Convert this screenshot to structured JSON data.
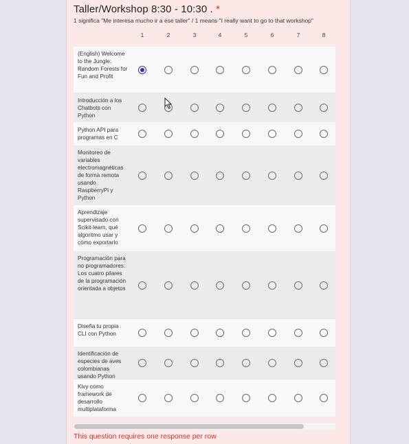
{
  "question": {
    "title": "Taller/Workshop 8:30 - 10:30 .",
    "required_mark": "*",
    "description": "1 significa \"Me interesa mucho ir a ese taller\" / 1 means \"I really want to go to that workshop\"",
    "error": "This question requires one response per row"
  },
  "columns": [
    "1",
    "2",
    "3",
    "4",
    "5",
    "6",
    "7",
    "8"
  ],
  "rows": [
    {
      "label": "(English) Welcome to the Jungle: Random Forests for Fun and Profit",
      "selected": "1"
    },
    {
      "label": "Introducción a los Chatbots con Python",
      "selected": null
    },
    {
      "label": "Python API para programas en C",
      "selected": null
    },
    {
      "label": "Monitoreo de variables electromagnéticas de forma remota usando RaspberryPi y Python",
      "selected": null
    },
    {
      "label": "Aprendizaje supervisado con Scikit-learn, qué algoritmo usar y cómo exportarlo",
      "selected": null
    },
    {
      "label": "Programación para no programadores: Los cuatro pilares de la programación orientada a objetos",
      "selected": null
    },
    {
      "label": "Diseña tu propia CLI con Python",
      "selected": null
    },
    {
      "label": "Identificación de especies de aves colombianas usando Python",
      "selected": null
    },
    {
      "label": "Kivy como framework de desarrollo multiplataforma",
      "selected": null
    }
  ],
  "colors": {
    "accent": "#4527a0",
    "error": "#d93025",
    "card": "#fde8e9"
  },
  "icons": {
    "cursor": "hand-pointer-icon"
  }
}
